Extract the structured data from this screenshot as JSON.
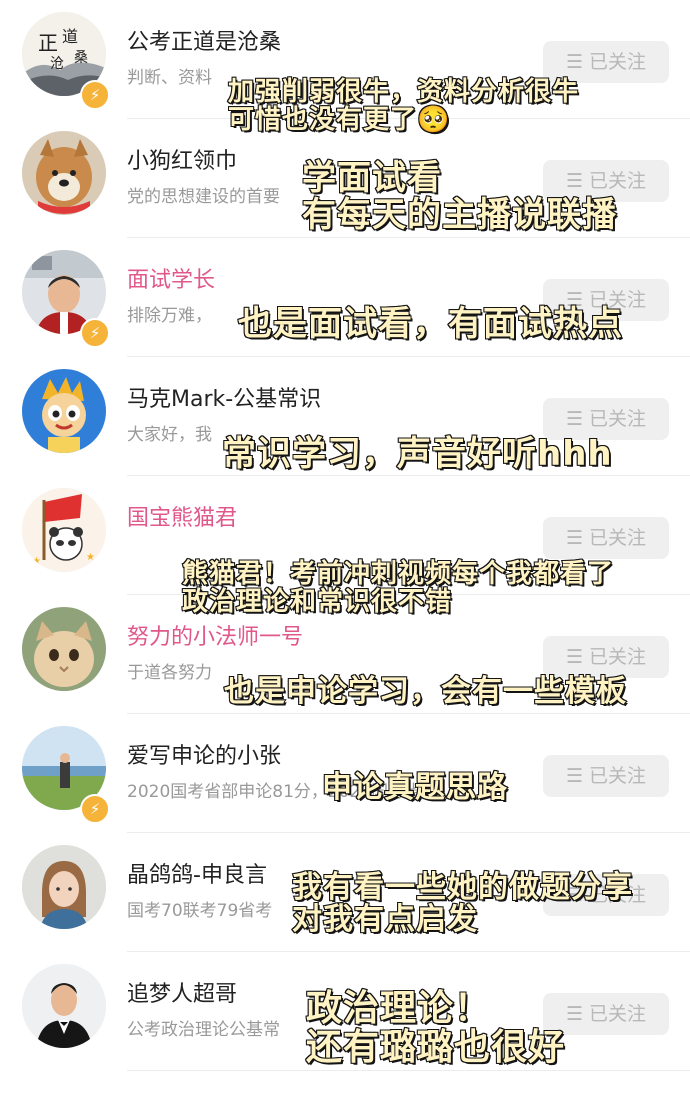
{
  "follow_label": "已关注",
  "accounts": [
    {
      "name": "公考正道是沧桑",
      "desc": "判断、资料",
      "name_color": "pink",
      "verified": true
    },
    {
      "name": "小狗红领巾",
      "desc": "党的思想建设的首要",
      "name_color": "default",
      "verified": false
    },
    {
      "name": "面试学长",
      "desc": "排除万难，",
      "name_color": "pink",
      "verified": true
    },
    {
      "name": "马克Mark-公基常识",
      "desc": "大家好，我",
      "name_color": "default",
      "verified": false
    },
    {
      "name": "国宝熊猫君",
      "desc": "",
      "name_color": "pink",
      "verified": false
    },
    {
      "name": "努力的小法师一号",
      "desc": "于道各努力",
      "name_color": "pink",
      "verified": false
    },
    {
      "name": "爱写申论的小张",
      "desc": "2020国考省部申论81分，2021国考省…",
      "name_color": "default",
      "verified": true
    },
    {
      "name": "晶鸽鸽-申良言",
      "desc": "国考70联考79省考",
      "name_color": "default",
      "verified": false
    },
    {
      "name": "追梦人超哥",
      "desc": "公考政治理论公基常",
      "name_color": "default",
      "verified": false
    }
  ],
  "annotations": [
    {
      "lines": [
        "加强削弱很牛，资料分析很牛",
        "可惜也没有更了🥺"
      ]
    },
    {
      "lines": [
        "学面试看",
        "有每天的主播说联播"
      ]
    },
    {
      "lines": [
        "也是面试看，有面试热点"
      ]
    },
    {
      "lines": [
        "常识学习，声音好听hhh"
      ]
    },
    {
      "lines": [
        "熊猫君！考前冲刺视频每个我都看了",
        "政治理论和常识很不错"
      ]
    },
    {
      "lines": [
        "也是申论学习，会有一些模板"
      ]
    },
    {
      "lines": [
        "申论真题思路"
      ]
    },
    {
      "lines": [
        "我有看一些她的做题分享",
        "对我有点启发"
      ]
    },
    {
      "lines": [
        "政治理论！",
        "还有璐璐也很好"
      ]
    }
  ]
}
